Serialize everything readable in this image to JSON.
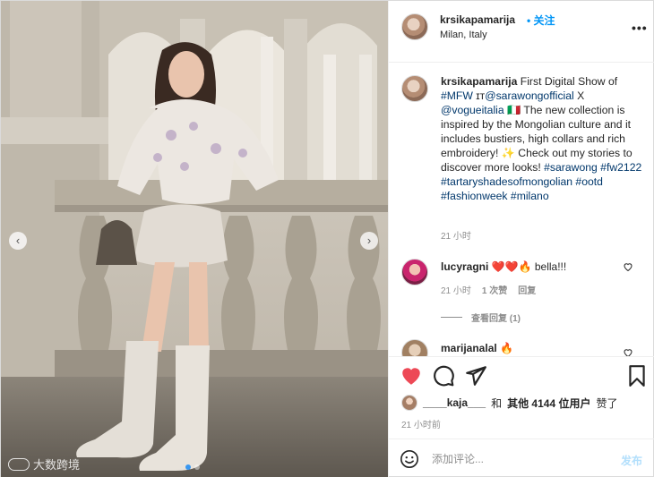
{
  "header": {
    "username": "krsikapamarija",
    "dot": "•",
    "follow_label": "关注",
    "location": "Milan, Italy",
    "more_label": "•••"
  },
  "caption": {
    "username": "krsikapamarija",
    "text_1": " First Digital Show of ",
    "tag_mfw": "#MFW",
    "text_2": " ",
    "glyph": "ɪᴛ",
    "tag_sarawongofficial": "@sarawongofficial",
    "text_3": " X ",
    "tag_vogueitalia": "@vogueitalia",
    "text_4": " 🇮🇹 The new collection is inspired by the Mongolian culture and it includes bustiers, high collars and rich embroidery! ✨ Check out my stories to discover more looks! ",
    "tag_sarawong": "#sarawong",
    "tag_fw2122": "#fw2122",
    "tag_tartary": "#tartaryshadesofmongolian",
    "tag_ootd": "#ootd",
    "tag_fashionweek": "#fashionweek",
    "tag_milano": "#milano",
    "time": "21 小时"
  },
  "comment_1": {
    "username": "lucyragni",
    "text": " ❤️❤️🔥 bella!!!",
    "time": "21 小时",
    "likes": "1 次赞",
    "reply_label": "回复",
    "view_replies": "查看回复 (1)"
  },
  "comment_2": {
    "username": "marijanalal",
    "text": " 🔥"
  },
  "likes": {
    "user": "____kaja___",
    "and": "和",
    "others": "其他 4144 位用户",
    "liked": "赞了"
  },
  "post_time": "21 小时前",
  "add_comment": {
    "placeholder": "添加评论...",
    "post_label": "发布"
  },
  "photo": {
    "prev_arrow": "‹",
    "next_arrow": "›",
    "watermark_text": "大数跨境",
    "watermark_logo": "Ko"
  },
  "colors": {
    "accent": "#0095f6",
    "heart": "#ed4956",
    "hashtag": "#00376b",
    "muted": "#8e8e8e"
  }
}
